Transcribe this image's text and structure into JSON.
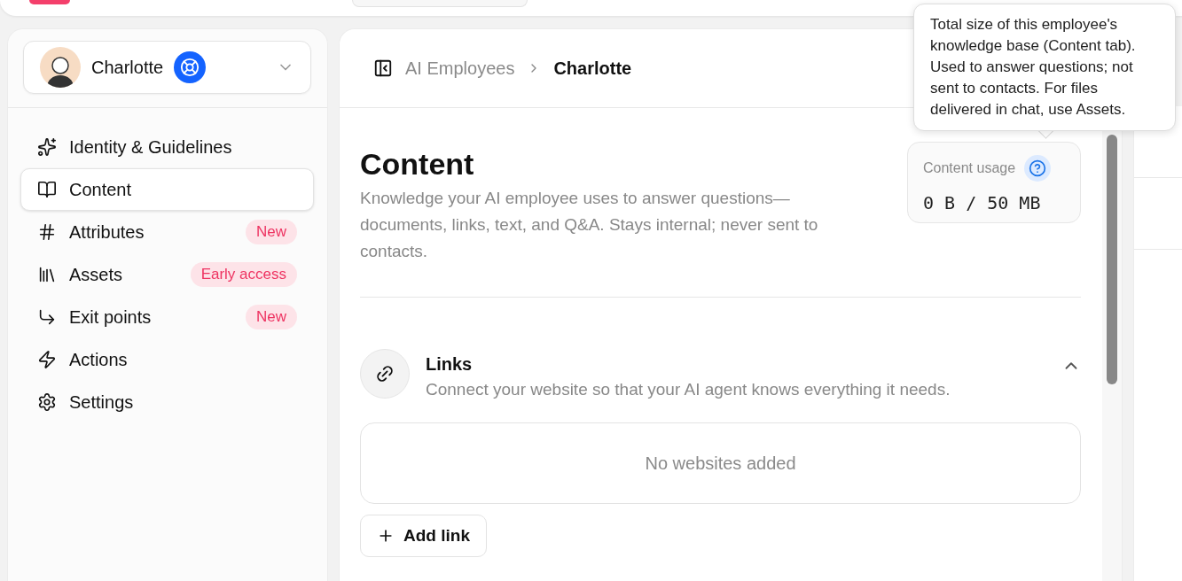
{
  "agent_selector": {
    "name": "Charlotte"
  },
  "nav": [
    {
      "label": "Identity & Guidelines",
      "selected": false
    },
    {
      "label": "Content",
      "selected": true
    },
    {
      "label": "Attributes",
      "selected": false,
      "badge": "New"
    },
    {
      "label": "Assets",
      "selected": false,
      "badge": "Early access"
    },
    {
      "label": "Exit points",
      "selected": false,
      "badge": "New"
    },
    {
      "label": "Actions",
      "selected": false
    },
    {
      "label": "Settings",
      "selected": false
    }
  ],
  "breadcrumb": [
    "AI Employees",
    "Charlotte"
  ],
  "page": {
    "title": "Content",
    "description": "Knowledge your AI employee uses to answer questions—documents, links, text, and Q&A. Stays internal; never sent to contacts."
  },
  "usage": {
    "label": "Content usage",
    "value": "0 B / 50 MB"
  },
  "tooltip": "Total size of this employee's knowledge base (Content tab). Used to answer questions; not sent to contacts. For files delivered in chat, use Assets.",
  "links_section": {
    "title": "Links",
    "description": "Connect your website so that your AI agent knows everything it needs.",
    "expanded": true,
    "empty_text": "No websites added",
    "add_button": "Add link"
  }
}
